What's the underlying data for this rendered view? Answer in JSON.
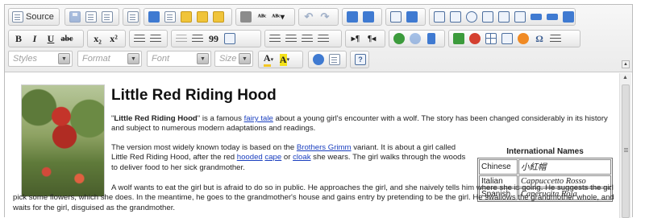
{
  "toolbar": {
    "source_label": "Source",
    "combos": {
      "styles": "Styles",
      "format": "Format",
      "font": "Font",
      "size": "Size"
    },
    "buttons": {
      "bold": "B",
      "italic": "I",
      "underline": "U",
      "strike": "abc",
      "subscript": "x₂",
      "superscript": "x²",
      "blockquote": "99",
      "ltr": "▸¶",
      "rtl": "¶◂",
      "text_color": "A",
      "bg_color": "A",
      "omega": "Ω",
      "help": "?"
    }
  },
  "document": {
    "title": "Little Red Riding Hood",
    "p1": {
      "bold": "Little Red Riding Hood",
      "t1": "\" is a famous ",
      "link1": "fairy tale",
      "t2": " about a young girl's encounter with a wolf. The story has been changed considerably in its history and subject to numerous modern adaptations and readings."
    },
    "p2": {
      "t1": "The version most widely known today is based on the ",
      "link1": "Brothers Grimm",
      "t2": " variant. It is about a girl called Little Red Riding Hood, after the red ",
      "link2": "hooded",
      "t3": " ",
      "link3": "cape",
      "t4": " or ",
      "link4": "cloak",
      "t5": " she wears. The girl walks through the woods to deliver food to her sick grandmother."
    },
    "p3": "A wolf wants to eat the girl but is afraid to do so in public. He approaches the girl, and she naively tells him where she is going. He suggests the girl pick some flowers, which she does. In the meantime, he goes to the grandmother's house and gains entry by pretending to be the girl. He swallows the grandmother whole, and waits for the girl, disguised as the grandmother.",
    "names_table": {
      "caption": "International Names",
      "rows": [
        {
          "lang": "Chinese",
          "name": "小紅帽"
        },
        {
          "lang": "Italian",
          "name": "Cappuccetto Rosso"
        },
        {
          "lang": "Spanish",
          "name": "Caperucita Roja"
        }
      ]
    }
  }
}
